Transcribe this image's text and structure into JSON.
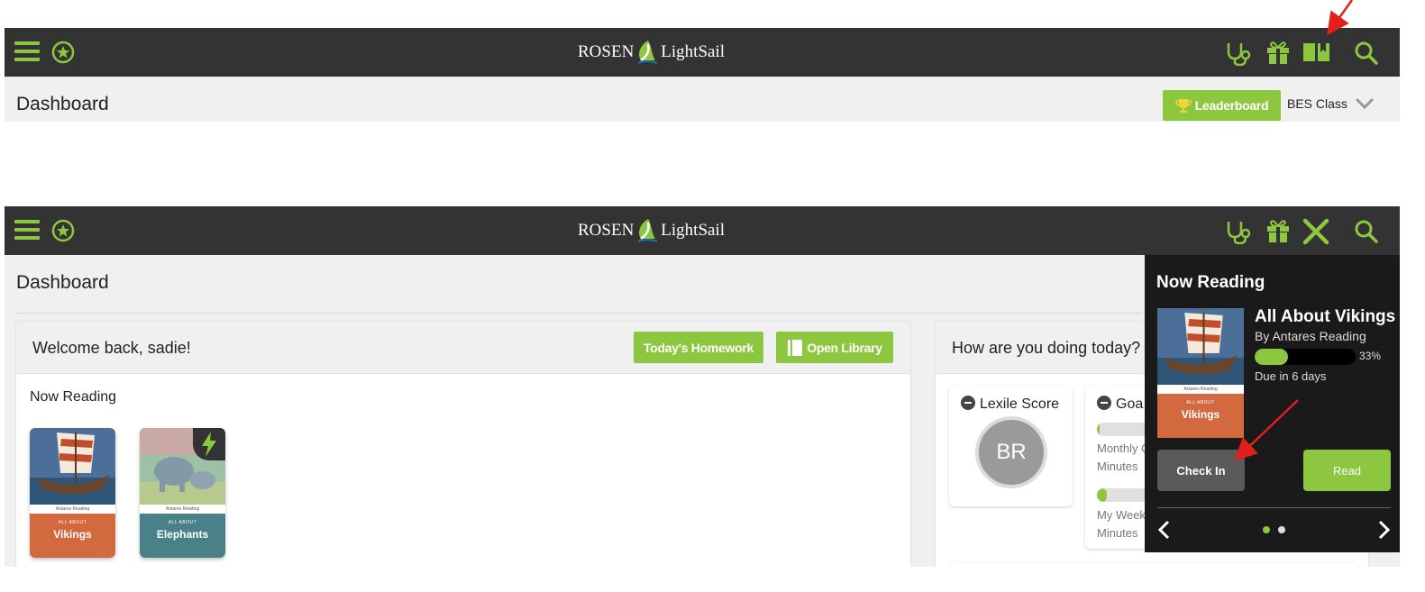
{
  "brand": {
    "left": "ROSEN",
    "right": "LightSail"
  },
  "colors": {
    "accent": "#8dc63f",
    "topbar": "#333333",
    "panel": "#1a1a1a",
    "vikings_band": "#d2693f",
    "elephants_band": "#4a8189",
    "annotation": "#e0201b"
  },
  "icons": {
    "menu": "hamburger-menu-icon",
    "badge": "star-circle-icon",
    "health": "stethoscope-icon",
    "gift": "gift-icon",
    "book": "open-book-icon",
    "close": "close-x-icon",
    "search": "search-icon",
    "trophy": "trophy-icon",
    "chevron": "chevron-down-icon",
    "library": "book-icon",
    "lightning": "lightning-icon"
  },
  "top": {
    "page_title": "Dashboard",
    "leaderboard_label": "Leaderboard",
    "class_name": "BES Class"
  },
  "main": {
    "page_title": "Dashboard",
    "welcome": {
      "title": "Welcome back, sadie!",
      "homework_label": "Today's Homework",
      "library_label": "Open Library",
      "section_label": "Now Reading",
      "books": [
        {
          "series": "ALL ABOUT",
          "title": "Vikings",
          "publisher": "Antares Reading"
        },
        {
          "series": "ALL ABOUT",
          "title": "Elephants",
          "publisher": "Antares Reading"
        }
      ]
    },
    "how_doing": {
      "title": "How are you doing today?",
      "lexile": {
        "label": "Lexile Score",
        "value": "BR"
      },
      "goals": {
        "label": "Goa",
        "monthly_label_1": "Monthly G",
        "monthly_label_2": "Minutes",
        "monthly_progress": 0.02,
        "weekly_label_1": "My Week",
        "weekly_label_2": "Minutes",
        "weekly_progress": 0.08
      }
    }
  },
  "panel": {
    "title": "Now Reading",
    "book_title": "All About Vikings",
    "author": "By Antares Reading",
    "progress": 0.33,
    "progress_label": "33%",
    "due": "Due in 6 days",
    "checkin_label": "Check In",
    "read_label": "Read",
    "cover": {
      "series": "ALL ABOUT",
      "title": "Vikings",
      "publisher": "Antares Reading"
    },
    "page_dots": 2,
    "active_dot": 0
  }
}
